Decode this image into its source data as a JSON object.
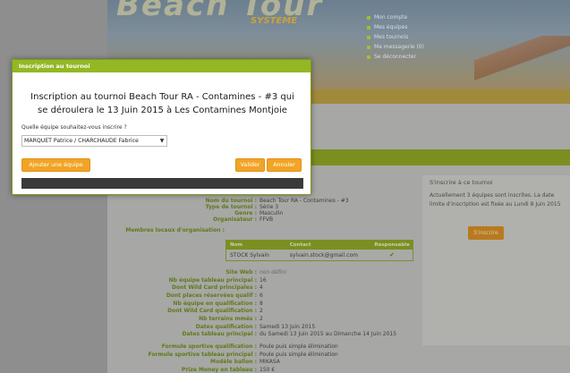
{
  "banner": {
    "logo_text": "Beach Tour",
    "subtitle": "SYSTEME",
    "menu": [
      "Mon compte",
      "Mes équipes",
      "Mes tournois",
      "Ma messagerie (0)",
      "Se déconnecter"
    ]
  },
  "sidebar": {
    "title": "S'inscrire à ce tournoi",
    "text": "Actuellement 3 équipes sont inscrites. La date limite d'inscription est fixée au Lundi 8 Juin 2015",
    "button_label": "S'inscrire"
  },
  "tournament_info": [
    {
      "label": "Nom du tournoi :",
      "value": "Beach Tour RA - Contamines - #3"
    },
    {
      "label": "Type de tournoi :",
      "value": "Série 3"
    },
    {
      "label": "Genre :",
      "value": "Masculin"
    },
    {
      "label": "Organisateur :",
      "value": "FFVB"
    },
    {
      "label": "Membres locaux d'organisation :",
      "value": ""
    }
  ],
  "members_table": {
    "headers": [
      "Nom",
      "Contact",
      "Responsable"
    ],
    "rows": [
      {
        "name": "STOCK Sylvain",
        "contact": "sylvain.stock@gmail.com",
        "responsable": "✔"
      }
    ]
  },
  "tournament_details": [
    {
      "label": "Site Web :",
      "value": "non défini",
      "muted": true
    },
    {
      "label": "Nb équipe tableau principal :",
      "value": "16"
    },
    {
      "label": "Dont Wild Card principales :",
      "value": "4"
    },
    {
      "label": "Dont places réservées qualif :",
      "value": "6"
    },
    {
      "label": "Nb équipe en qualification :",
      "value": "8"
    },
    {
      "label": "Dont Wild Card qualification :",
      "value": "2"
    },
    {
      "label": "Nb terrains mmés :",
      "value": "2"
    },
    {
      "label": "Dates qualification :",
      "value": "Samedi 13 Juin 2015"
    },
    {
      "label": "Dates tableau principal :",
      "value": "du Samedi 13 Juin 2015 au Dimanche 14 Juin 2015"
    },
    {
      "label": "Formule sportive qualification :",
      "value": "Poule puis simple élimination"
    },
    {
      "label": "Formule sportive tableau principal :",
      "value": "Poule puis simple élimination"
    },
    {
      "label": "Modèle ballon :",
      "value": "MIKASA"
    },
    {
      "label": "Prize Money en tableau :",
      "value": "150 €"
    }
  ],
  "modal": {
    "title": "Inscription au tournoi",
    "heading": "Inscription au tournoi Beach Tour RA - Contamines - #3 qui se déroulera le 13 Juin 2015 à Les Contamines Montjoie",
    "question": "Quelle équipe souhaitez-vous inscrire ?",
    "selected_team": "MARQUET Patrice / CHARCHAUDE Fabrice",
    "add_team_label": "Ajouter une équipe",
    "validate_label": "Valider",
    "cancel_label": "Annuler"
  },
  "colors": {
    "accent_green": "#94b824",
    "button_orange": "#f2a425",
    "label_green": "#5d7a1a"
  }
}
